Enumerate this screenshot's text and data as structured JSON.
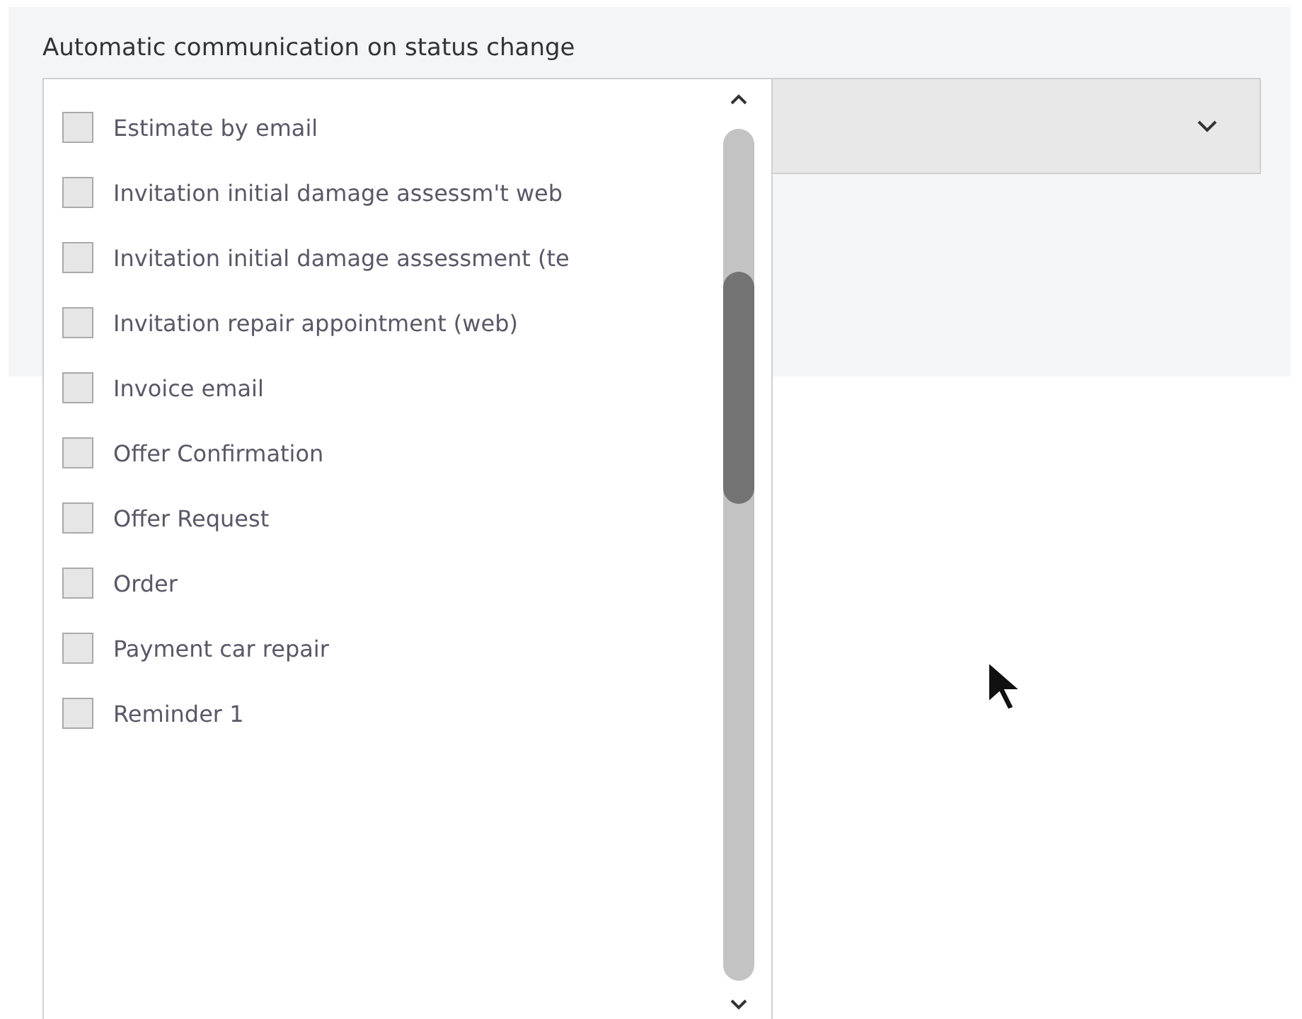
{
  "field": {
    "label": "Automatic communication on status change"
  },
  "options": [
    {
      "label": "Estimate by email",
      "checked": false
    },
    {
      "label": "Invitation initial damage assessm't web",
      "checked": false
    },
    {
      "label": "Invitation initial damage assessment (te",
      "checked": false
    },
    {
      "label": "Invitation repair appointment (web)",
      "checked": false
    },
    {
      "label": "Invoice email",
      "checked": false
    },
    {
      "label": "Offer Confirmation",
      "checked": false
    },
    {
      "label": "Offer Request",
      "checked": false
    },
    {
      "label": "Order",
      "checked": false
    },
    {
      "label": "Payment car repair",
      "checked": false
    },
    {
      "label": "Reminder 1",
      "checked": false
    }
  ]
}
